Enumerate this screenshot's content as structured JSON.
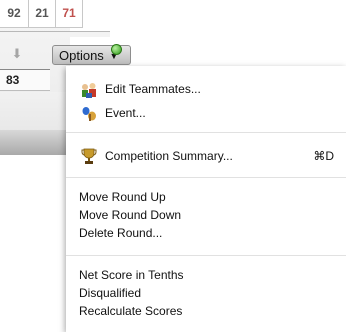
{
  "scores": {
    "a": "92",
    "b": "21",
    "c": "71"
  },
  "current_value": "83",
  "toolbar": {
    "options_label": "Options",
    "options_caret": "▼"
  },
  "icons": {
    "move_down": "down-arrow-icon",
    "status": "green-status-icon",
    "teammates": "teammates-icon",
    "event": "event-icon",
    "trophy": "trophy-icon"
  },
  "menu": {
    "group1": [
      {
        "label": "Edit Teammates..."
      },
      {
        "label": "Event..."
      }
    ],
    "group2": [
      {
        "label": "Competition Summary...",
        "shortcut": "⌘D"
      }
    ],
    "group3": [
      {
        "label": "Move Round Up"
      },
      {
        "label": "Move Round Down"
      },
      {
        "label": "Delete Round..."
      }
    ],
    "group4": [
      {
        "label": "Net Score in Tenths"
      },
      {
        "label": "Disqualified"
      },
      {
        "label": "Recalculate Scores"
      }
    ]
  },
  "colors": {
    "score_highlight": "#c0504d",
    "status_green": "#2f9a1a"
  }
}
